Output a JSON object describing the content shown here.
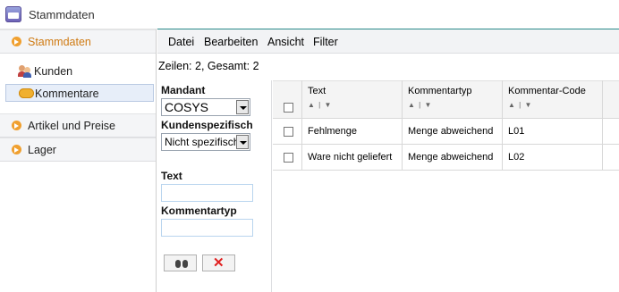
{
  "window": {
    "title": "Stammdaten"
  },
  "sidebar": {
    "sections": [
      {
        "label": "Stammdaten",
        "items": [
          "Kunden",
          "Kommentare"
        ]
      },
      {
        "label": "Artikel und Preise"
      },
      {
        "label": "Lager"
      }
    ]
  },
  "menu": [
    "Datei",
    "Bearbeiten",
    "Ansicht",
    "Filter"
  ],
  "status": {
    "rows": "Zeilen: 2, Gesamt: 2"
  },
  "filter": {
    "mandant_label": "Mandant",
    "mandant_value": "COSYS",
    "kundenspezifisch_label": "Kundenspezifisch",
    "kundenspezifisch_value": "Nicht spezifisch",
    "text_label": "Text",
    "text_value": "",
    "kommentartyp_label": "Kommentartyp",
    "kommentartyp_value": ""
  },
  "table": {
    "columns": [
      "Text",
      "Kommentartyp",
      "Kommentar-Code"
    ],
    "rows": [
      [
        "Fehlmenge",
        "Menge abweichend",
        "L01"
      ],
      [
        "Ware nicht geliefert",
        "Menge abweichend",
        "L02"
      ]
    ]
  }
}
